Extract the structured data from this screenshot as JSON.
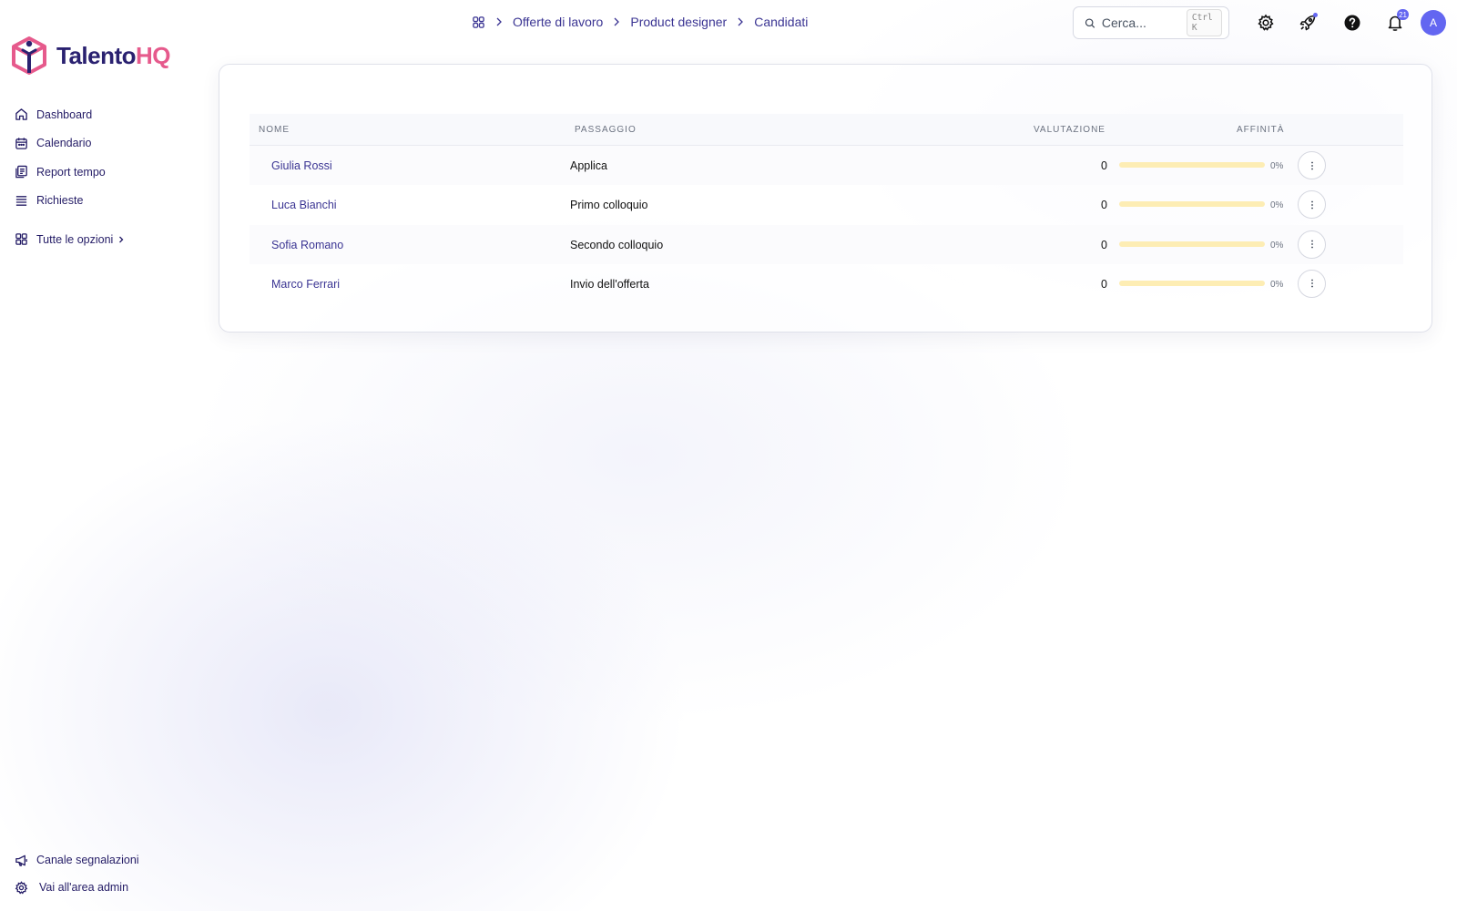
{
  "brand": {
    "part1": "Talento",
    "part2": "HQ",
    "primary": "#2a2170",
    "accent": "#e65a8c"
  },
  "sidebar": {
    "items": [
      {
        "label": "Dashboard",
        "icon": "home-icon"
      },
      {
        "label": "Calendario",
        "icon": "calendar-icon"
      },
      {
        "label": "Report tempo",
        "icon": "report-icon"
      },
      {
        "label": "Richieste",
        "icon": "list-icon"
      }
    ],
    "all_options": "Tutte le opzioni",
    "bottom": [
      {
        "label": "Canale segnalazioni",
        "icon": "megaphone-icon"
      },
      {
        "label": "Vai all'area admin",
        "icon": "gear-icon"
      }
    ]
  },
  "breadcrumb": [
    "Offerte di lavoro",
    "Product designer",
    "Candidati"
  ],
  "search": {
    "placeholder": "Cerca...",
    "shortcut": "Ctrl K"
  },
  "topbar": {
    "icons": [
      "settings-icon",
      "rocket-icon",
      "help-icon",
      "bell-icon"
    ],
    "notification_count": "21",
    "avatar": "A",
    "accent": "#6366f1"
  },
  "table": {
    "headers": {
      "name": "NOME",
      "stage": "PASSAGGIO",
      "score": "VALUTAZIONE",
      "affinity": "AFFINITÀ"
    },
    "rows": [
      {
        "name": "Giulia Rossi",
        "stage": "Applica",
        "score": "0",
        "affinity": 0,
        "affinity_label": "0%"
      },
      {
        "name": "Luca Bianchi",
        "stage": "Primo colloquio",
        "score": "0",
        "affinity": 0,
        "affinity_label": "0%"
      },
      {
        "name": "Sofia Romano",
        "stage": "Secondo colloquio",
        "score": "0",
        "affinity": 0,
        "affinity_label": "0%"
      },
      {
        "name": "Marco Ferrari",
        "stage": "Invio dell'offerta",
        "score": "0",
        "affinity": 0,
        "affinity_label": "0%"
      }
    ]
  }
}
